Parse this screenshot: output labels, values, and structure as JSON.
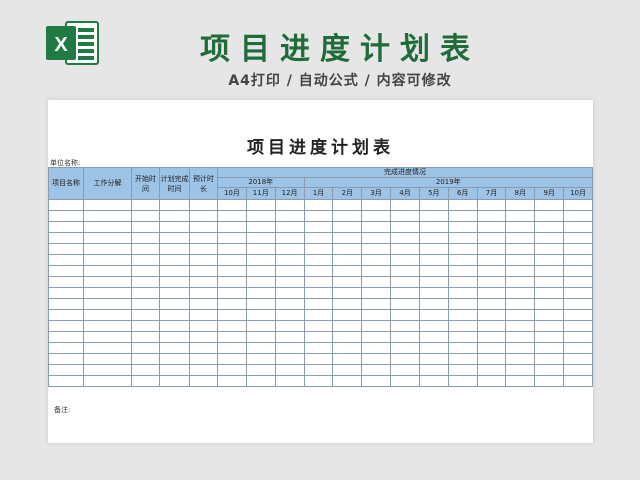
{
  "header": {
    "title": "项目进度计划表",
    "subtitle": "A4打印 / 自动公式 / 内容可修改",
    "logo_letter": "X",
    "accent_color": "#1f6b3a"
  },
  "sheet": {
    "title": "项目进度计划表",
    "unit_label": "单位名称:",
    "remark_label": "备注:"
  },
  "table": {
    "columns": {
      "project_name": "项目名称",
      "work_breakdown": "工作分解",
      "start_time": "开始时间",
      "planned_finish": "计划完成时间",
      "duration": "预计时长"
    },
    "progress_header": "完成进度情况",
    "year_groups": [
      {
        "year": "2018年",
        "months": [
          "10月",
          "11月",
          "12月"
        ]
      },
      {
        "year": "2019年",
        "months": [
          "1月",
          "2月",
          "3月",
          "4月",
          "5月",
          "6月",
          "7月",
          "8月",
          "9月",
          "10月"
        ]
      }
    ],
    "empty_rows": 17,
    "header_color": "#9dc3e6"
  }
}
